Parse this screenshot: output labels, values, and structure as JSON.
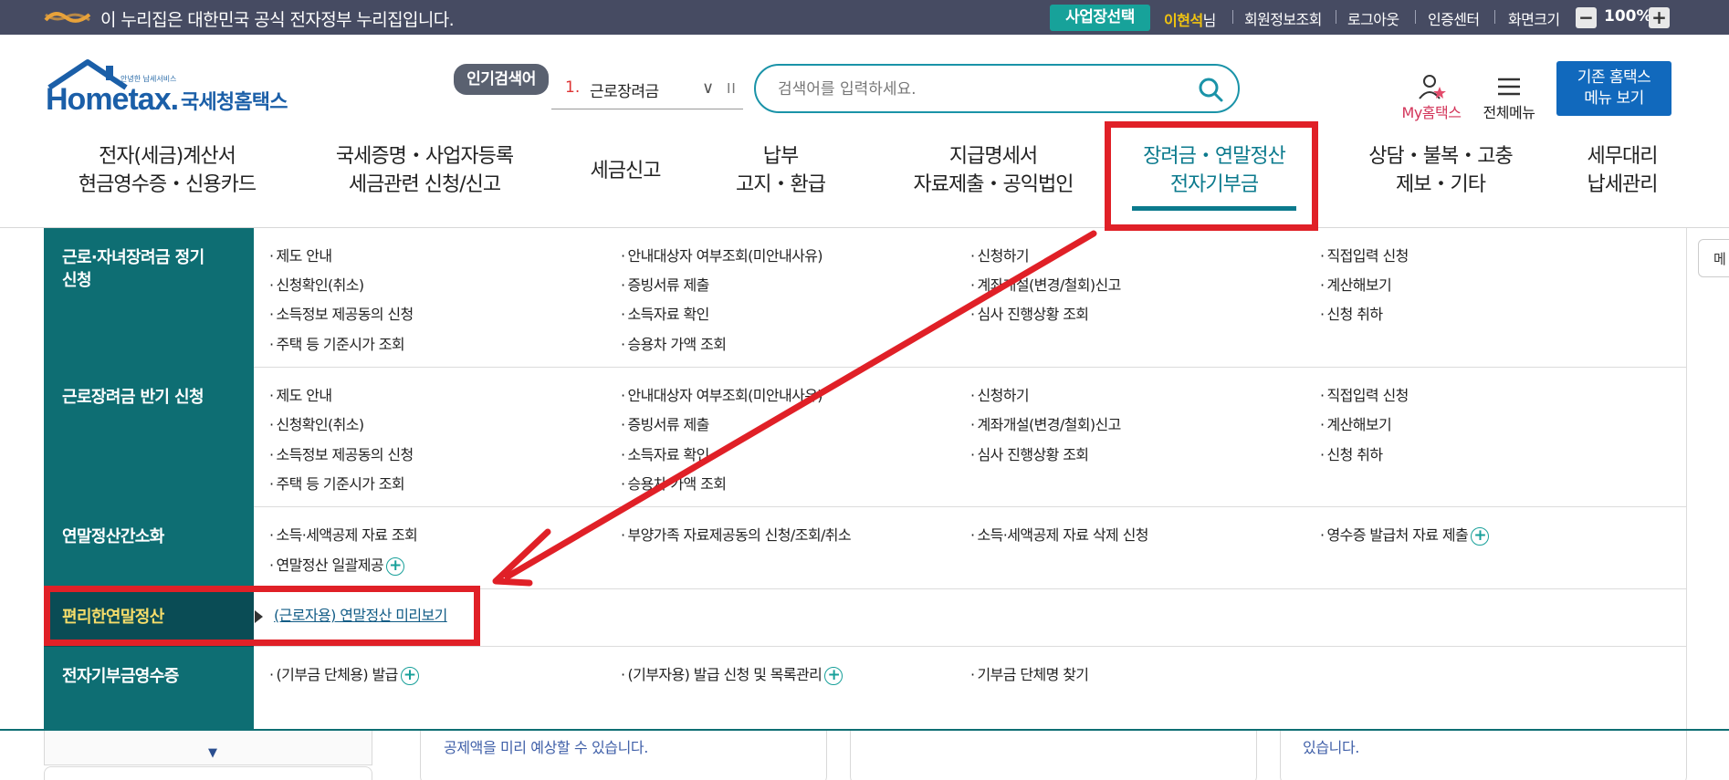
{
  "gov_bar": {
    "text": "이 누리집은 대한민국 공식 전자정부 누리집입니다.",
    "biz_select": "사업장선택",
    "user_name": "이현석",
    "user_suffix": "님",
    "links": [
      "회원정보조회",
      "로그아웃",
      "인증센터",
      "화면크기"
    ],
    "zoom_minus": "−",
    "zoom_value": "100%",
    "zoom_plus": "+"
  },
  "header": {
    "logo_small": "안녕한 납세서비스",
    "logo_text": "Hometax.",
    "logo_ko": "국세청홈택스",
    "popular_badge": "인기검색어",
    "popular_rank": "1.",
    "popular_term": "근로장려금",
    "popular_chevron": "∨",
    "popular_pause": "II",
    "search_placeholder": "검색어를 입력하세요.",
    "my_hometax": "My홈택스",
    "all_menu": "전체메뉴",
    "old_hometax_line1": "기존 홈택스",
    "old_hometax_line2": "메뉴 보기"
  },
  "gnb": [
    {
      "line1": "전자(세금)계산서",
      "line2": "현금영수증・신용카드"
    },
    {
      "line1": "국세증명・사업자등록",
      "line2": "세금관련 신청/신고"
    },
    {
      "line1": "세금신고",
      "line2": ""
    },
    {
      "line1": "납부",
      "line2": "고지・환급"
    },
    {
      "line1": "지급명세서",
      "line2": "자료제출・공익법인"
    },
    {
      "line1": "장려금・연말정산",
      "line2": "전자기부금"
    },
    {
      "line1": "상담・불복・고충",
      "line2": "제보・기타"
    },
    {
      "line1": "세무대리",
      "line2": "납세관리"
    }
  ],
  "mega": {
    "sections": [
      {
        "title_line1": "근로·자녀장려금 정기",
        "title_line2": "신청",
        "items": [
          "제도 안내",
          "안내대상자 여부조회(미안내사유)",
          "신청하기",
          "직접입력 신청",
          "신청확인(취소)",
          "증빙서류 제출",
          "계좌개설(변경/철회)신고",
          "계산해보기",
          "소득정보 제공동의 신청",
          "소득자료 확인",
          "심사 진행상황 조회",
          "신청 취하",
          "주택 등 기준시가 조회",
          "승용차 가액 조회"
        ]
      },
      {
        "title_line1": "근로장려금 반기 신청",
        "items": [
          "제도 안내",
          "안내대상자 여부조회(미안내사유)",
          "신청하기",
          "직접입력 신청",
          "신청확인(취소)",
          "증빙서류 제출",
          "계좌개설(변경/철회)신고",
          "계산해보기",
          "소득정보 제공동의 신청",
          "소득자료 확인",
          "심사 진행상황 조회",
          "신청 취하",
          "주택 등 기준시가 조회",
          "승용차 가액 조회"
        ]
      },
      {
        "title_line1": "연말정산간소화",
        "items": [
          "소득·세액공제 자료 조회",
          "부양가족 자료제공동의 신청/조회/취소",
          "소득·세액공제 자료 삭제 신청",
          "영수증 발급처 자료 제출",
          "연말정산 일괄제공"
        ]
      },
      {
        "title_line1": "편리한연말정산",
        "items": [
          "(근로자용) 연말정산 미리보기"
        ]
      },
      {
        "title_line1": "전자기부금영수증",
        "items": [
          "(기부금 단체용) 발급",
          "(기부자용) 발급 신청 및 목록관리",
          "기부금 단체명 찾기"
        ]
      }
    ]
  },
  "side_tab": "메",
  "background": {
    "card1_text": "공제액을 미리 예상할 수 있습니다.",
    "card3_text": "있습니다.",
    "down_arrow": "▼"
  }
}
